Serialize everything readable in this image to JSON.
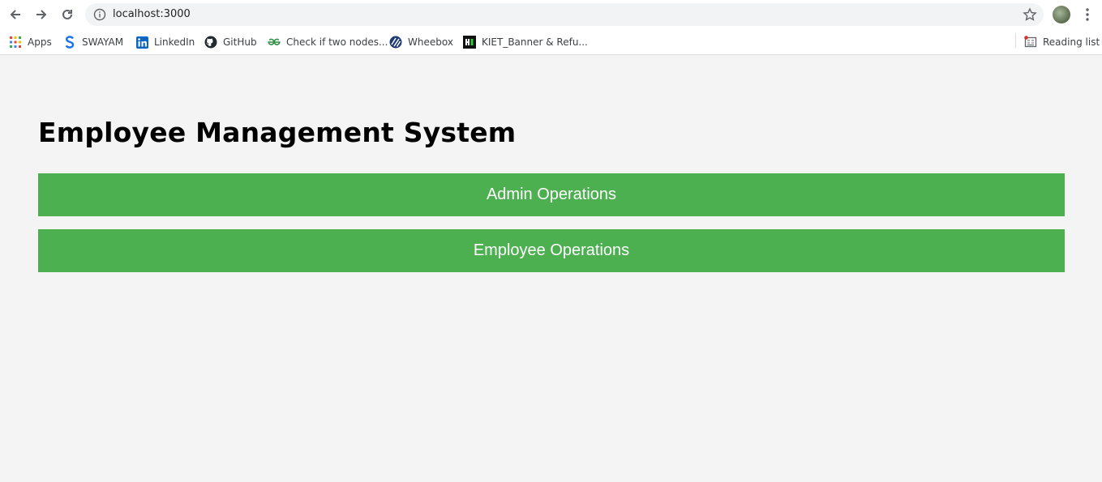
{
  "browser": {
    "url": "localhost:3000",
    "bookmarks": [
      {
        "label": "Apps",
        "icon": "apps-grid-icon"
      },
      {
        "label": "SWAYAM",
        "icon": "swayam-icon"
      },
      {
        "label": "LinkedIn",
        "icon": "linkedin-icon"
      },
      {
        "label": "GitHub",
        "icon": "github-icon"
      },
      {
        "label": "Check if two nodes...",
        "icon": "geeksforgeeks-icon"
      },
      {
        "label": "Wheebox",
        "icon": "wheebox-icon"
      },
      {
        "label": "KIET_Banner & Refu...",
        "icon": "kiet-icon"
      }
    ],
    "reading_list": "Reading list"
  },
  "page": {
    "title": "Employee Management System",
    "buttons": {
      "admin": "Admin Operations",
      "employee": "Employee Operations"
    }
  },
  "colors": {
    "button_bg": "#4caf50",
    "page_bg": "#f4f4f4"
  }
}
